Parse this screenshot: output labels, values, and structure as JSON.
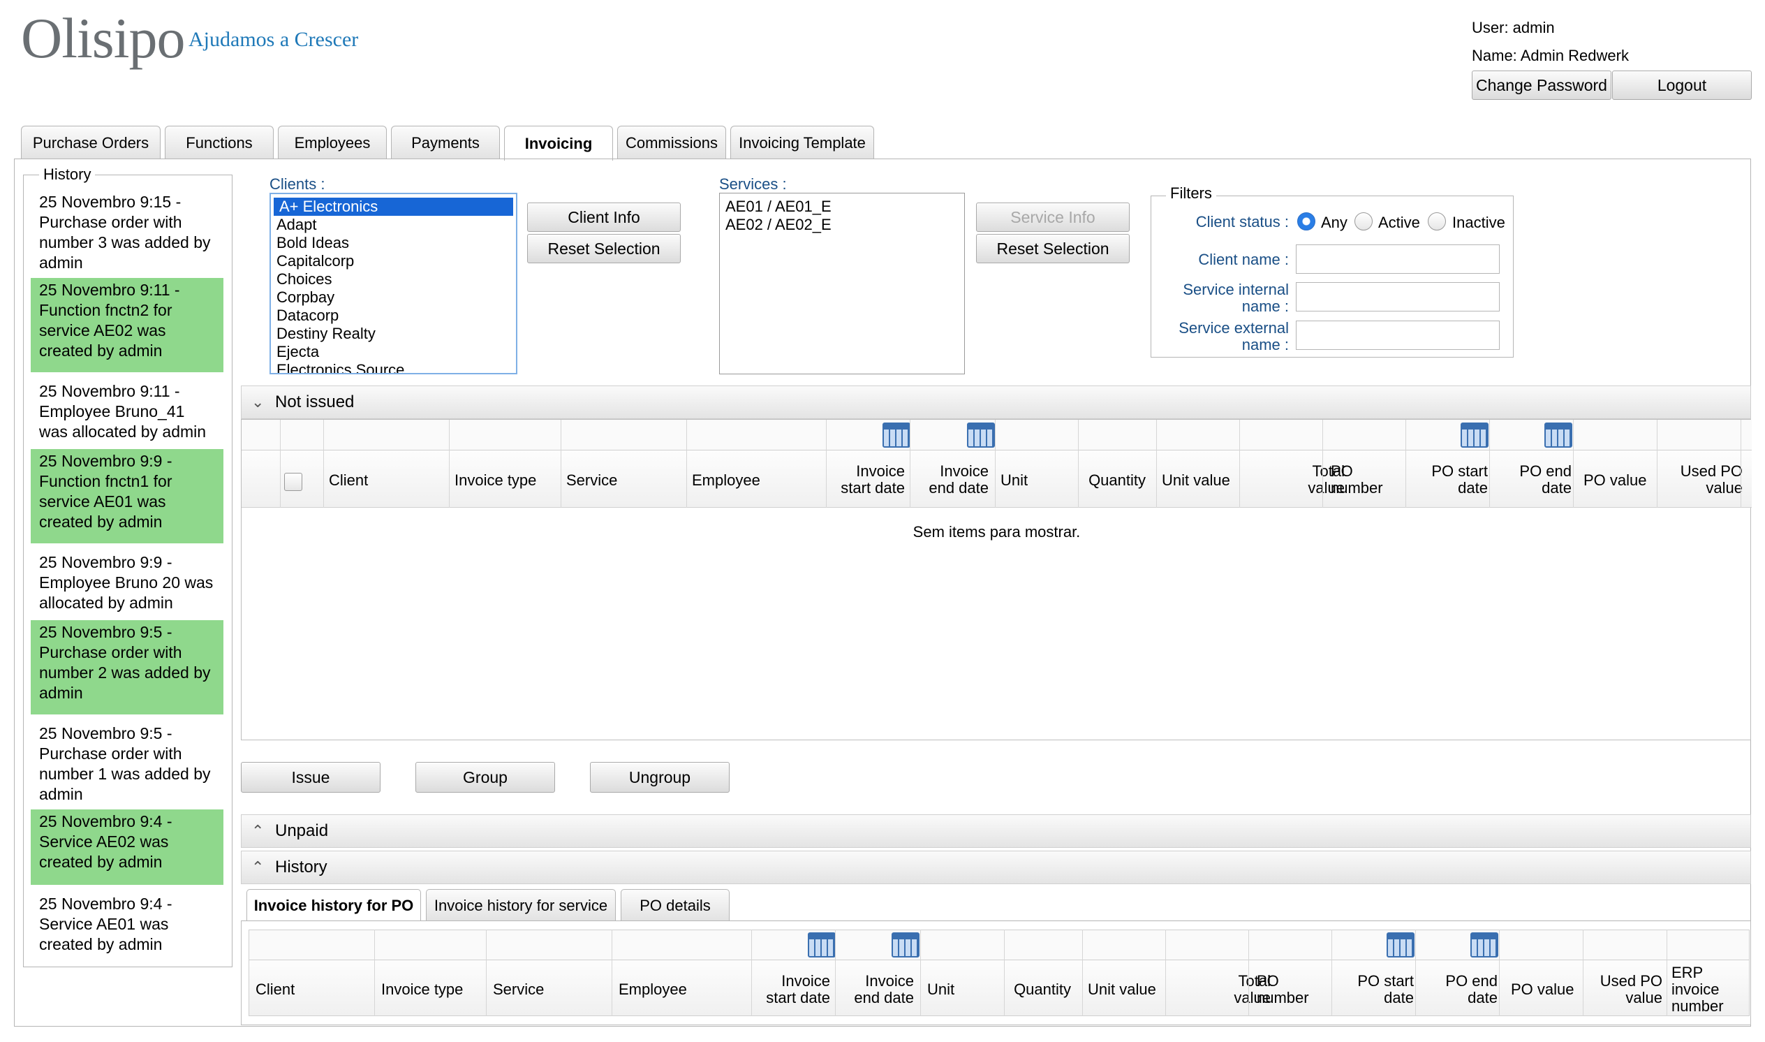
{
  "brand": {
    "logo_text": "Olisipo",
    "tagline": "Ajudamos a Crescer"
  },
  "user": {
    "user_line": "User: admin",
    "name_line": "Name: Admin Redwerk",
    "change_password": "Change Password",
    "logout": "Logout"
  },
  "tabs": [
    "Purchase Orders",
    "Functions",
    "Employees",
    "Payments",
    "Invoicing",
    "Commissions",
    "Invoicing Template"
  ],
  "active_tab": "Invoicing",
  "history": {
    "title": "History",
    "items": [
      {
        "text": "25 Novembro 9:15 - Purchase order with number 3 was added by admin",
        "highlight": false
      },
      {
        "text": "25 Novembro 9:11 - Function fnctn2 for service AE02 was created by admin",
        "highlight": true
      },
      {
        "text": "25 Novembro 9:11 - Employee Bruno_41 was allocated by admin",
        "highlight": false
      },
      {
        "text": "25 Novembro 9:9 - Function fnctn1 for service AE01 was created by admin",
        "highlight": true
      },
      {
        "text": "25 Novembro 9:9 - Employee Bruno 20 was allocated by admin",
        "highlight": false
      },
      {
        "text": "25 Novembro 9:5 - Purchase order with number 2 was added by admin",
        "highlight": true
      },
      {
        "text": "25 Novembro 9:5 - Purchase order with number 1 was added by admin",
        "highlight": false
      },
      {
        "text": "25 Novembro 9:4 - Service AE02 was created by admin",
        "highlight": true
      },
      {
        "text": "25 Novembro 9:4 - Service AE01 was created by admin",
        "highlight": false
      }
    ]
  },
  "clients": {
    "label": "Clients :",
    "options": [
      "A+ Electronics",
      "Adapt",
      "Bold Ideas",
      "Capitalcorp",
      "Choices",
      "Corpbay",
      "Datacorp",
      "Destiny Realty",
      "Ejecta",
      "Electronics Source"
    ],
    "selected": "A+ Electronics",
    "info_button": "Client Info",
    "reset_button": "Reset Selection"
  },
  "services": {
    "label": "Services :",
    "options": [
      "AE01 / AE01_E",
      "AE02 / AE02_E"
    ],
    "info_button": "Service Info",
    "reset_button": "Reset Selection"
  },
  "filters": {
    "title": "Filters",
    "client_status_label": "Client status :",
    "status_options": [
      "Any",
      "Active",
      "Inactive"
    ],
    "status_selected": "Any",
    "client_name_label": "Client name :",
    "client_name_value": "",
    "service_internal_label_1": "Service internal",
    "service_internal_label_2": "name :",
    "service_internal_value": "",
    "service_external_label_1": "Service external",
    "service_external_label_2": "name :",
    "service_external_value": ""
  },
  "not_issued": {
    "title": "Not issued",
    "columns": [
      "Client",
      "Invoice type",
      "Service",
      "Employee",
      "Invoice start date",
      "Invoice end date",
      "Unit",
      "Quantity",
      "Unit value",
      "Total value",
      "PO number",
      "PO start date",
      "PO end date",
      "PO value",
      "Used PO value"
    ],
    "empty_message": "Sem items para mostrar.",
    "buttons": {
      "issue": "Issue",
      "group": "Group",
      "ungroup": "Ungroup"
    }
  },
  "unpaid": {
    "title": "Unpaid"
  },
  "history_panel": {
    "title": "History",
    "subtabs": [
      "Invoice history for PO",
      "Invoice history for service",
      "PO details"
    ],
    "active_subtab": "Invoice history for PO",
    "columns": [
      "Client",
      "Invoice type",
      "Service",
      "Employee",
      "Invoice start date",
      "Invoice end date",
      "Unit",
      "Quantity",
      "Unit value",
      "Total value",
      "PO number",
      "PO start date",
      "PO end date",
      "PO value",
      "Used PO value",
      "ERP invoice number"
    ]
  },
  "colors": {
    "history_highlight": "#8fd88c",
    "selection": "#1766d6",
    "label_blue": "#1a4f86"
  }
}
